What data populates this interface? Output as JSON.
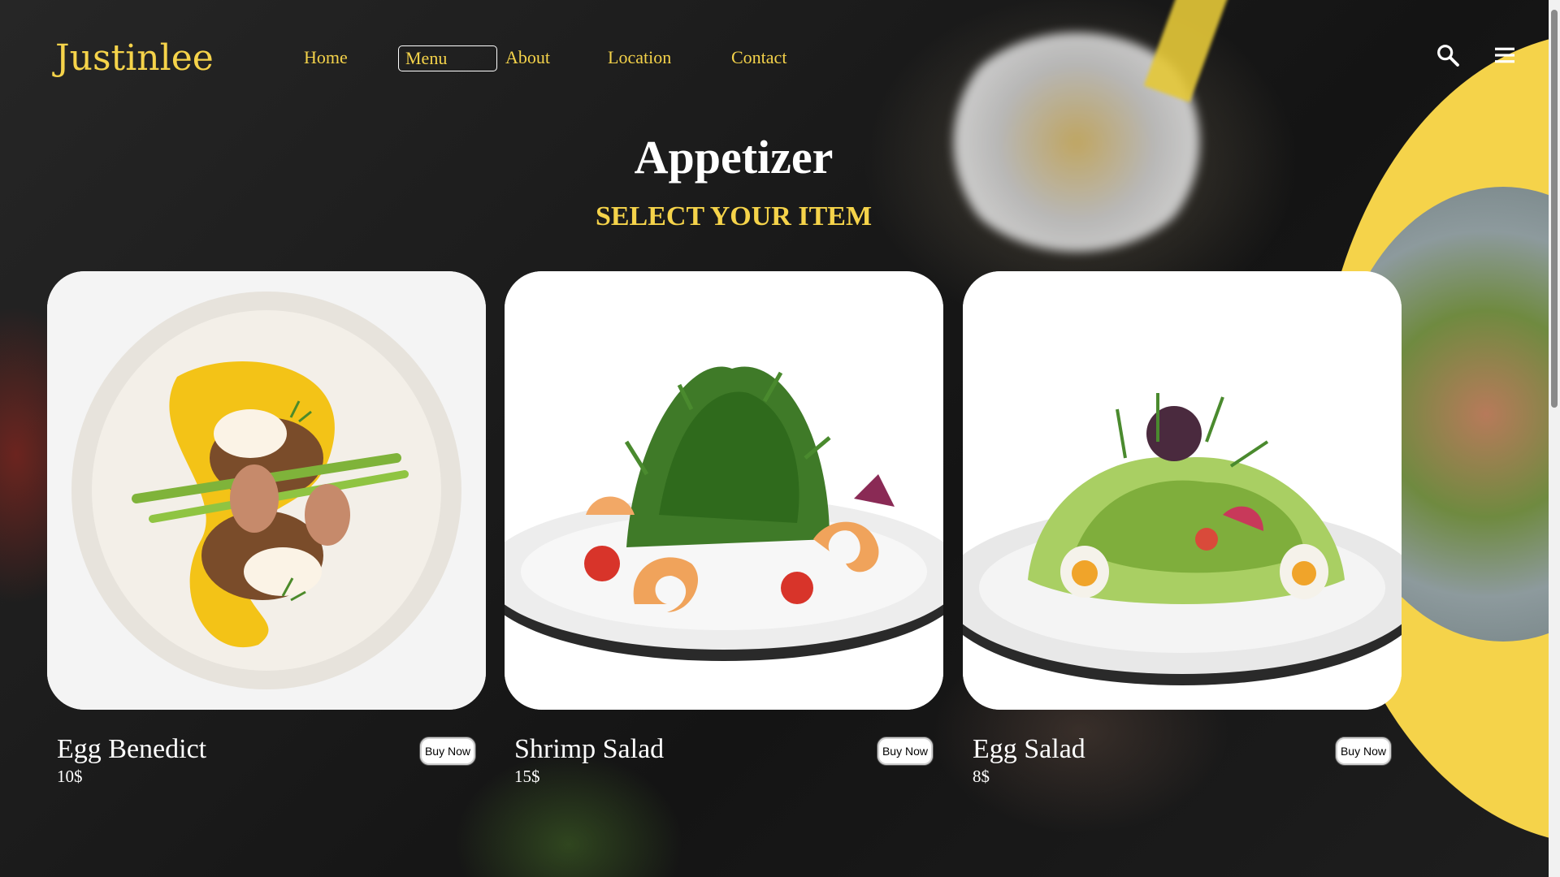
{
  "brand": {
    "name": "Justinlee",
    "accent_color": "#f5d34a"
  },
  "nav": {
    "items": [
      {
        "label": "Home",
        "active": false
      },
      {
        "label": "Menu",
        "active": true
      },
      {
        "label": "About",
        "active": false
      },
      {
        "label": "Location",
        "active": false
      },
      {
        "label": "Contact",
        "active": false
      }
    ]
  },
  "icons": {
    "search": "search-icon",
    "menu": "hamburger-menu-icon"
  },
  "section": {
    "title": "Appetizer",
    "subtitle": "SELECT YOUR ITEM"
  },
  "items": [
    {
      "name": "Egg Benedict",
      "price": "10$",
      "button_label": "Buy Now"
    },
    {
      "name": "Shrimp Salad",
      "price": "15$",
      "button_label": "Buy Now"
    },
    {
      "name": "Egg Salad",
      "price": "8$",
      "button_label": "Buy Now"
    }
  ]
}
